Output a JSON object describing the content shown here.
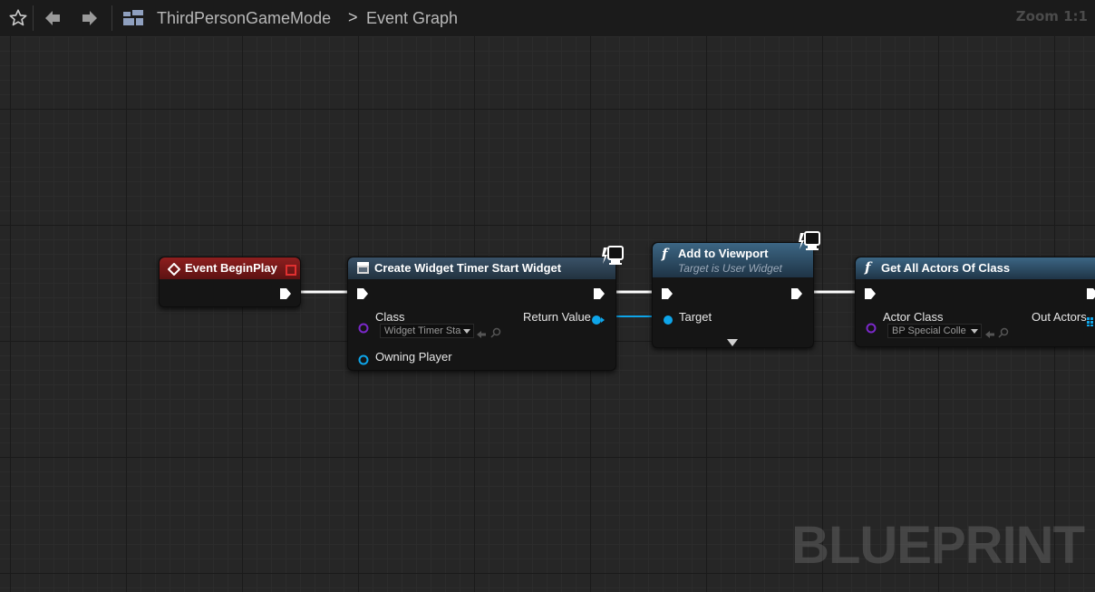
{
  "toolbar": {
    "breadcrumb_root": "ThirdPersonGameMode",
    "breadcrumb_current": "Event Graph",
    "zoom": "Zoom 1:1"
  },
  "watermark": "BLUEPRINT",
  "nodes": {
    "begin_play": {
      "title": "Event BeginPlay",
      "header_color": "#7e1a1a"
    },
    "create_widget": {
      "title": "Create Widget Timer Start Widget",
      "header_color": "#2a3e50",
      "class_label": "Class",
      "class_value": "Widget Timer Sta",
      "owning_player_label": "Owning Player",
      "return_value_label": "Return Value"
    },
    "add_to_viewport": {
      "title": "Add to Viewport",
      "subtitle": "Target is User Widget",
      "header_color": "#2a4f6a",
      "target_label": "Target"
    },
    "get_all_actors": {
      "title": "Get All Actors Of Class",
      "header_color": "#2a4f6a",
      "actor_class_label": "Actor Class",
      "actor_class_value": "BP Special Colle",
      "out_actors_label": "Out Actors"
    }
  },
  "colors": {
    "exec_wire": "#ffffff",
    "object_pin": "#0ea5e9",
    "class_pin": "#6b21a8"
  }
}
